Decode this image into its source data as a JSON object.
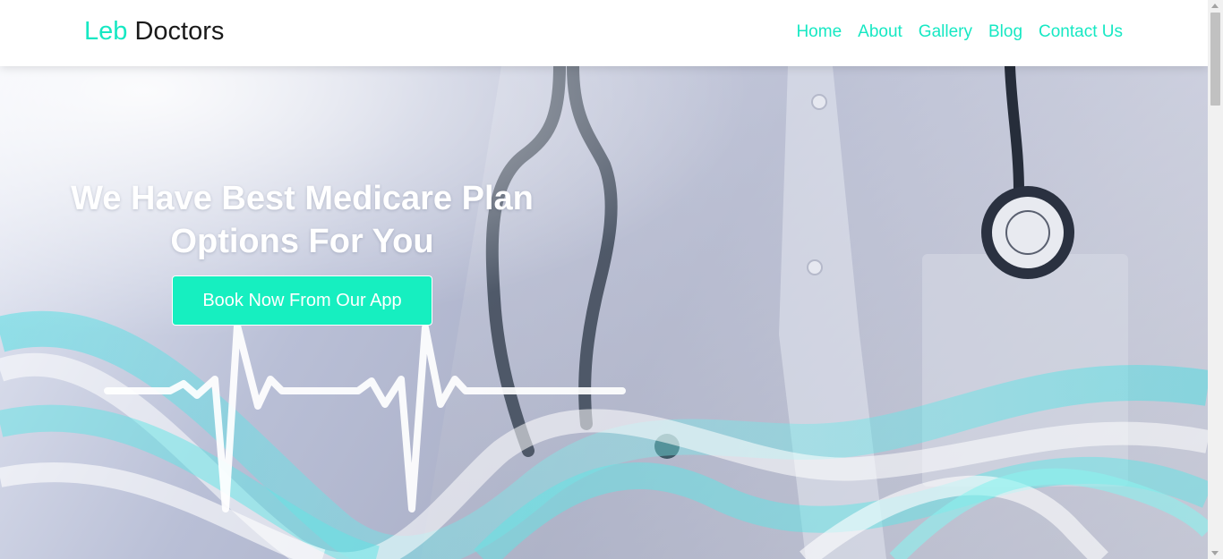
{
  "brand": {
    "accent": "Leb",
    "rest": " Doctors"
  },
  "nav": {
    "items": [
      "Home",
      "About",
      "Gallery",
      "Blog",
      "Contact Us"
    ]
  },
  "hero": {
    "title_line1": "We Have Best Medicare Plan",
    "title_line2": "Options For You",
    "cta_label": "Book Now From Our App"
  },
  "colors": {
    "accent": "#16e8c3",
    "button": "#16efc0"
  }
}
